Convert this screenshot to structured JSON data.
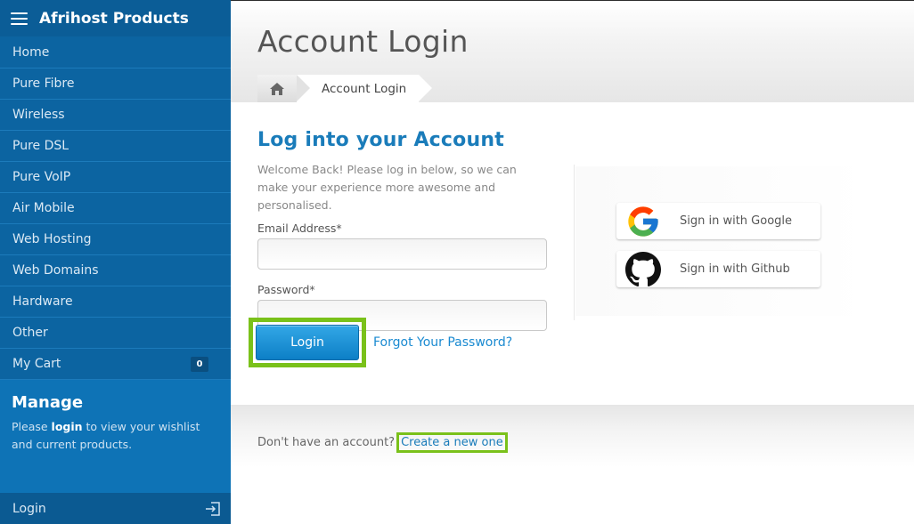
{
  "sidebar": {
    "title": "Afrihost Products",
    "items": [
      {
        "label": "Home"
      },
      {
        "label": "Pure Fibre"
      },
      {
        "label": "Wireless"
      },
      {
        "label": "Pure DSL"
      },
      {
        "label": "Pure VoIP"
      },
      {
        "label": "Air Mobile"
      },
      {
        "label": "Web Hosting"
      },
      {
        "label": "Web Domains"
      },
      {
        "label": "Hardware"
      },
      {
        "label": "Other"
      }
    ],
    "cart": {
      "label": "My Cart",
      "count": "0"
    },
    "manage": {
      "title": "Manage",
      "text_before": "Please ",
      "login_link": "login",
      "text_after": " to view your wishlist and current products."
    },
    "footer": {
      "label": "Login"
    }
  },
  "header": {
    "title": "Account Login",
    "breadcrumb_current": "Account Login"
  },
  "form": {
    "title": "Log into your Account",
    "description": "Welcome Back! Please log in below, so we can make your experience more awesome and personalised.",
    "email_label": "Email Address*",
    "email_value": "",
    "password_label": "Password*",
    "password_value": "",
    "login_button": "Login",
    "forgot_link": "Forgot Your Password?"
  },
  "social": {
    "google_label": "Sign in with Google",
    "github_label": "Sign in with Github"
  },
  "footer_prompt": {
    "text": "Don't have an account?",
    "link": "Create a new one"
  },
  "colors": {
    "sidebar_bg": "#0e69a8",
    "accent": "#1a7cba",
    "highlight": "#7ac11a"
  }
}
